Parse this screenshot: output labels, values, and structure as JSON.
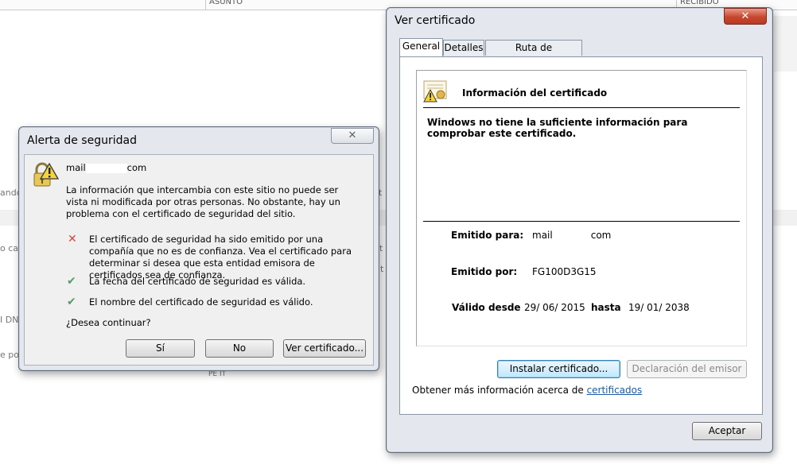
{
  "background": {
    "columns": {
      "subject": "ASUNTO",
      "received": "RECIBIDO"
    },
    "fragments": [
      "ando",
      "o ca",
      "t",
      "t",
      "I DN",
      "e poc",
      "t",
      "PE IT"
    ]
  },
  "alert_dialog": {
    "title": "Alerta de seguridad",
    "site_prefix": "mail",
    "site_suffix": "com",
    "intro": "La información que intercambia con este sitio no puede ser vista ni modificada por otras personas. No obstante, hay un problema con el certificado de seguridad del sitio.",
    "issues": [
      {
        "status": "error",
        "text": "El certificado de seguridad ha sido emitido por una compañía que no es de confianza. Vea el certificado para determinar si desea que esta entidad emisora de certificados sea de confianza."
      },
      {
        "status": "ok",
        "text": "La fecha del certificado de seguridad es válida."
      },
      {
        "status": "ok",
        "text": "El nombre del certificado de seguridad es válido."
      }
    ],
    "question": "¿Desea continuar?",
    "buttons": {
      "yes": "Sí",
      "no": "No",
      "view": "Ver certificado..."
    },
    "close_glyph": "✕"
  },
  "cert_dialog": {
    "title": "Ver certificado",
    "close_glyph": "✕",
    "tabs": [
      "General",
      "Detalles",
      "Ruta de certificación"
    ],
    "active_tab": "General",
    "heading": "Información del certificado",
    "warning": "Windows no tiene la suficiente información para comprobar este certificado.",
    "issued_to_label": "Emitido para:",
    "issued_to_prefix": "mail",
    "issued_to_suffix": "com",
    "issued_by_label": "Emitido por:",
    "issued_by_value": "FG100D3G15",
    "valid_from_label": "Válido desde",
    "valid_from": "29/ 06/ 2015",
    "valid_to_label": "hasta",
    "valid_to": "19/ 01/ 2038",
    "install_button": "Instalar certificado...",
    "issuer_statement_button": "Declaración del emisor",
    "more_info_text": "Obtener más información acerca de",
    "more_info_link": "certificados",
    "ok_button": "Aceptar"
  }
}
